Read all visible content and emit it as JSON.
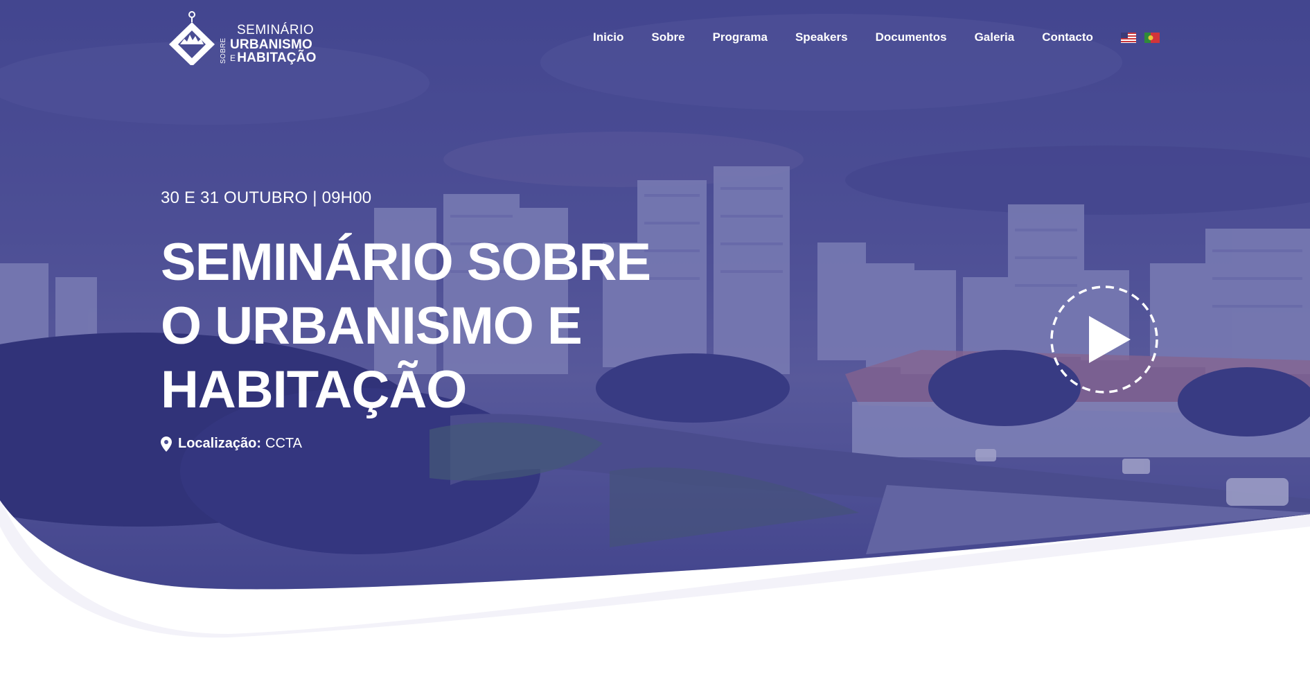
{
  "logo": {
    "top": "SEMINÁRIO",
    "sobre": "SOBRE",
    "line1": "URBANISMO",
    "e": "E",
    "line2": "HABITAÇÃO"
  },
  "nav": {
    "items": [
      "Inicio",
      "Sobre",
      "Programa",
      "Speakers",
      "Documentos",
      "Galeria",
      "Contacto"
    ],
    "languages": [
      "english-flag-icon",
      "portuguese-flag-icon"
    ]
  },
  "hero": {
    "date": "30 E 31 OUTUBRO | 09H00",
    "title_lines": [
      "SEMINÁRIO SOBRE",
      "O URBANISMO E",
      "HABITAÇÃO"
    ],
    "location_label": "Localização:",
    "location_value": "CCTA",
    "play_icon": "play-icon"
  },
  "colors": {
    "overlay": "#3f4190",
    "overlay_dark": "#2b2d6e",
    "curve_light": "#f3f2f9",
    "text": "#ffffff"
  }
}
